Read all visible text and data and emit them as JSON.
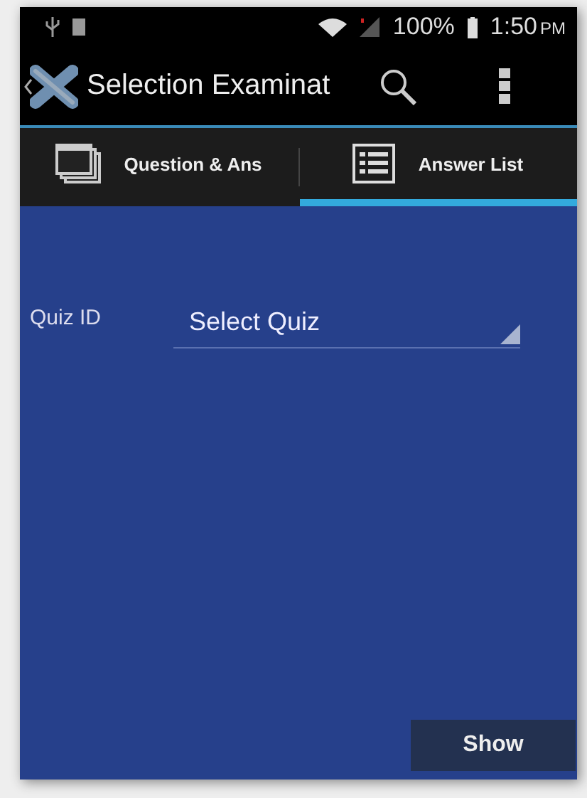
{
  "status_bar": {
    "battery": "100%",
    "time": "1:50",
    "time_suffix": "PM"
  },
  "action_bar": {
    "title": "Selection Examinat"
  },
  "tabs": [
    {
      "label": "Question & Ans",
      "kind": "windows",
      "selected": false
    },
    {
      "label": "Answer List",
      "kind": "list",
      "selected": true
    }
  ],
  "form": {
    "label": "Quiz ID",
    "spinner": {
      "value": "Select Quiz"
    }
  },
  "buttons": [
    "Show"
  ]
}
